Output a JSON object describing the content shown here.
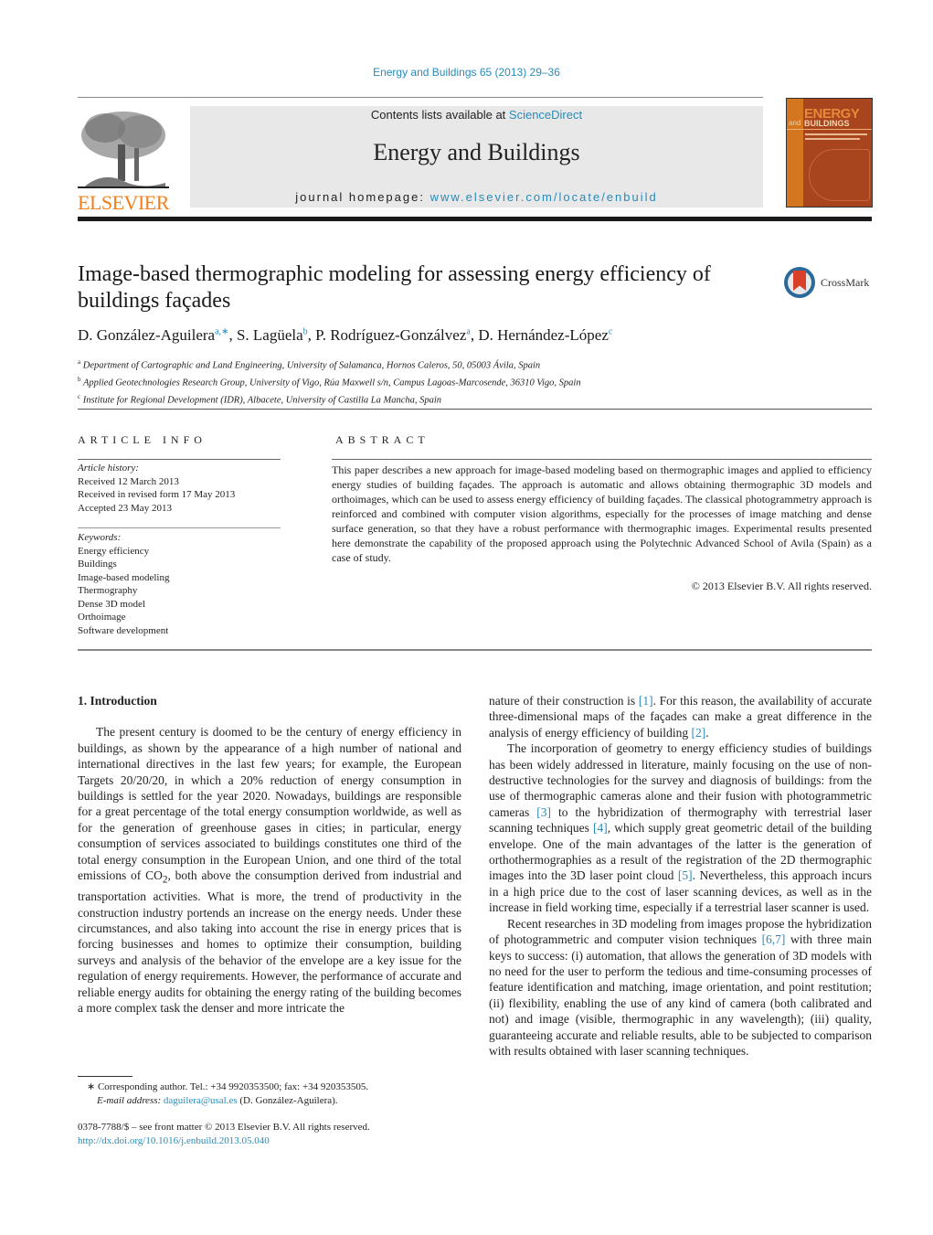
{
  "header": {
    "running_head": "Energy and Buildings 65 (2013) 29–36",
    "contents_prefix": "Contents lists available at ",
    "contents_link": "ScienceDirect",
    "journal_title": "Energy and Buildings",
    "homepage_prefix": "journal homepage: ",
    "homepage_url": "www.elsevier.com/locate/enbuild",
    "publisher_logo_text": "ELSEVIER",
    "cover": {
      "energy": "ENERGY",
      "and": "and",
      "buildings": "BUILDINGS"
    },
    "crossmark_label": "CrossMark"
  },
  "colors": {
    "link": "#2a8bb8",
    "elsevier_orange": "#f07f1d",
    "cover_bg": "#a8441e"
  },
  "article": {
    "title": "Image-based thermographic modeling for assessing energy efficiency of buildings façades",
    "authors": [
      {
        "name": "D. González-Aguilera",
        "sup": "a,∗"
      },
      {
        "name": "S. Lagüela",
        "sup": "b"
      },
      {
        "name": "P. Rodríguez-Gonzálvez",
        "sup": "a"
      },
      {
        "name": "D. Hernández-López",
        "sup": "c"
      }
    ],
    "affiliations": [
      {
        "sup": "a",
        "text": "Department of Cartographic and Land Engineering, University of Salamanca, Hornos Caleros, 50, 05003 Ávila, Spain"
      },
      {
        "sup": "b",
        "text": "Applied Geotechnologies Research Group, University of Vigo, Rúa Maxwell s/n, Campus Lagoas-Marcosende, 36310 Vigo, Spain"
      },
      {
        "sup": "c",
        "text": "Institute for Regional Development (IDR), Albacete, University of Castilla La Mancha, Spain"
      }
    ]
  },
  "article_info": {
    "heading": "ARTICLE INFO",
    "history_label": "Article history:",
    "history": [
      "Received 12 March 2013",
      "Received in revised form 17 May 2013",
      "Accepted 23 May 2013"
    ],
    "keywords_label": "Keywords:",
    "keywords": [
      "Energy efficiency",
      "Buildings",
      "Image-based modeling",
      "Thermography",
      "Dense 3D model",
      "Orthoimage",
      "Software development"
    ]
  },
  "abstract": {
    "heading": "ABSTRACT",
    "text": "This paper describes a new approach for image-based modeling based on thermographic images and applied to efficiency energy studies of building façades. The approach is automatic and allows obtaining thermographic 3D models and orthoimages, which can be used to assess energy efficiency of building façades. The classical photogrammetry approach is reinforced and combined with computer vision algorithms, especially for the processes of image matching and dense surface generation, so that they have a robust performance with thermographic images. Experimental results presented here demonstrate the capability of the proposed approach using the Polytechnic Advanced School of Avila (Spain) as a case of study.",
    "copyright": "© 2013 Elsevier B.V. All rights reserved."
  },
  "body": {
    "section_heading": "1.  Introduction",
    "left_p1": "The present century is doomed to be the century of energy efficiency in buildings, as shown by the appearance of a high number of national and international directives in the last few years; for example, the European Targets 20/20/20, in which a 20% reduction of energy consumption in buildings is settled for the year 2020. Nowadays, buildings are responsible for a great percentage of the total energy consumption worldwide, as well as for the generation of greenhouse gases in cities; in particular, energy consumption of services associated to buildings constitutes one third of the total energy consumption in the European Union, and one third of the total emissions of CO",
    "co2_sub": "2",
    "left_p1_rest": ", both above the consumption derived from industrial and transportation activities. What is more, the trend of productivity in the construction industry portends an increase on the energy needs. Under these circumstances, and also taking into account the rise in energy prices that is forcing businesses and homes to optimize their consumption, building surveys and analysis of the behavior of the envelope are a key issue for the regulation of energy requirements. However, the performance of accurate and reliable energy audits for obtaining the energy rating of the building becomes a more complex task the denser and more intricate the",
    "right_p1a": "nature of their construction is ",
    "ref1": "[1]",
    "right_p1b": ". For this reason, the availability of accurate three-dimensional maps of the façades can make a great difference in the analysis of energy efficiency of building ",
    "ref2": "[2]",
    "right_p1c": ".",
    "right_p2a": "The incorporation of geometry to energy efficiency studies of buildings has been widely addressed in literature, mainly focusing on the use of non-destructive technologies for the survey and diagnosis of buildings: from the use of thermographic cameras alone and their fusion with photogrammetric cameras ",
    "ref3": "[3]",
    "right_p2b": " to the hybridization of thermography with terrestrial laser scanning techniques ",
    "ref4": "[4]",
    "right_p2c": ", which supply great geometric detail of the building envelope. One of the main advantages of the latter is the generation of orthothermographies as a result of the registration of the 2D thermographic images into the 3D laser point cloud ",
    "ref5": "[5]",
    "right_p2d": ". Nevertheless, this approach incurs in a high price due to the cost of laser scanning devices, as well as in the increase in field working time, especially if a terrestrial laser scanner is used.",
    "right_p3a": "Recent researches in 3D modeling from images propose the hybridization of photogrammetric and computer vision techniques ",
    "ref67": "[6,7]",
    "right_p3b": " with three main keys to success: (i) automation, that allows the generation of 3D models with no need for the user to perform the tedious and time-consuming processes of feature identification and matching, image orientation, and point restitution; (ii) flexibility, enabling the use of any kind of camera (both calibrated and not) and image (visible, thermographic in any wavelength); (iii) quality, guaranteeing accurate and reliable results, able to be subjected to comparison with results obtained with laser scanning techniques."
  },
  "footnotes": {
    "corresponding": "∗  Corresponding author. Tel.: +34 9920353500; fax: +34 920353505.",
    "email_label": "E-mail address:",
    "email": "daguilera@usal.es",
    "email_suffix": " (D. González-Aguilera).",
    "front_matter": "0378-7788/$ – see front matter © 2013 Elsevier B.V. All rights reserved.",
    "doi": "http://dx.doi.org/10.1016/j.enbuild.2013.05.040"
  }
}
